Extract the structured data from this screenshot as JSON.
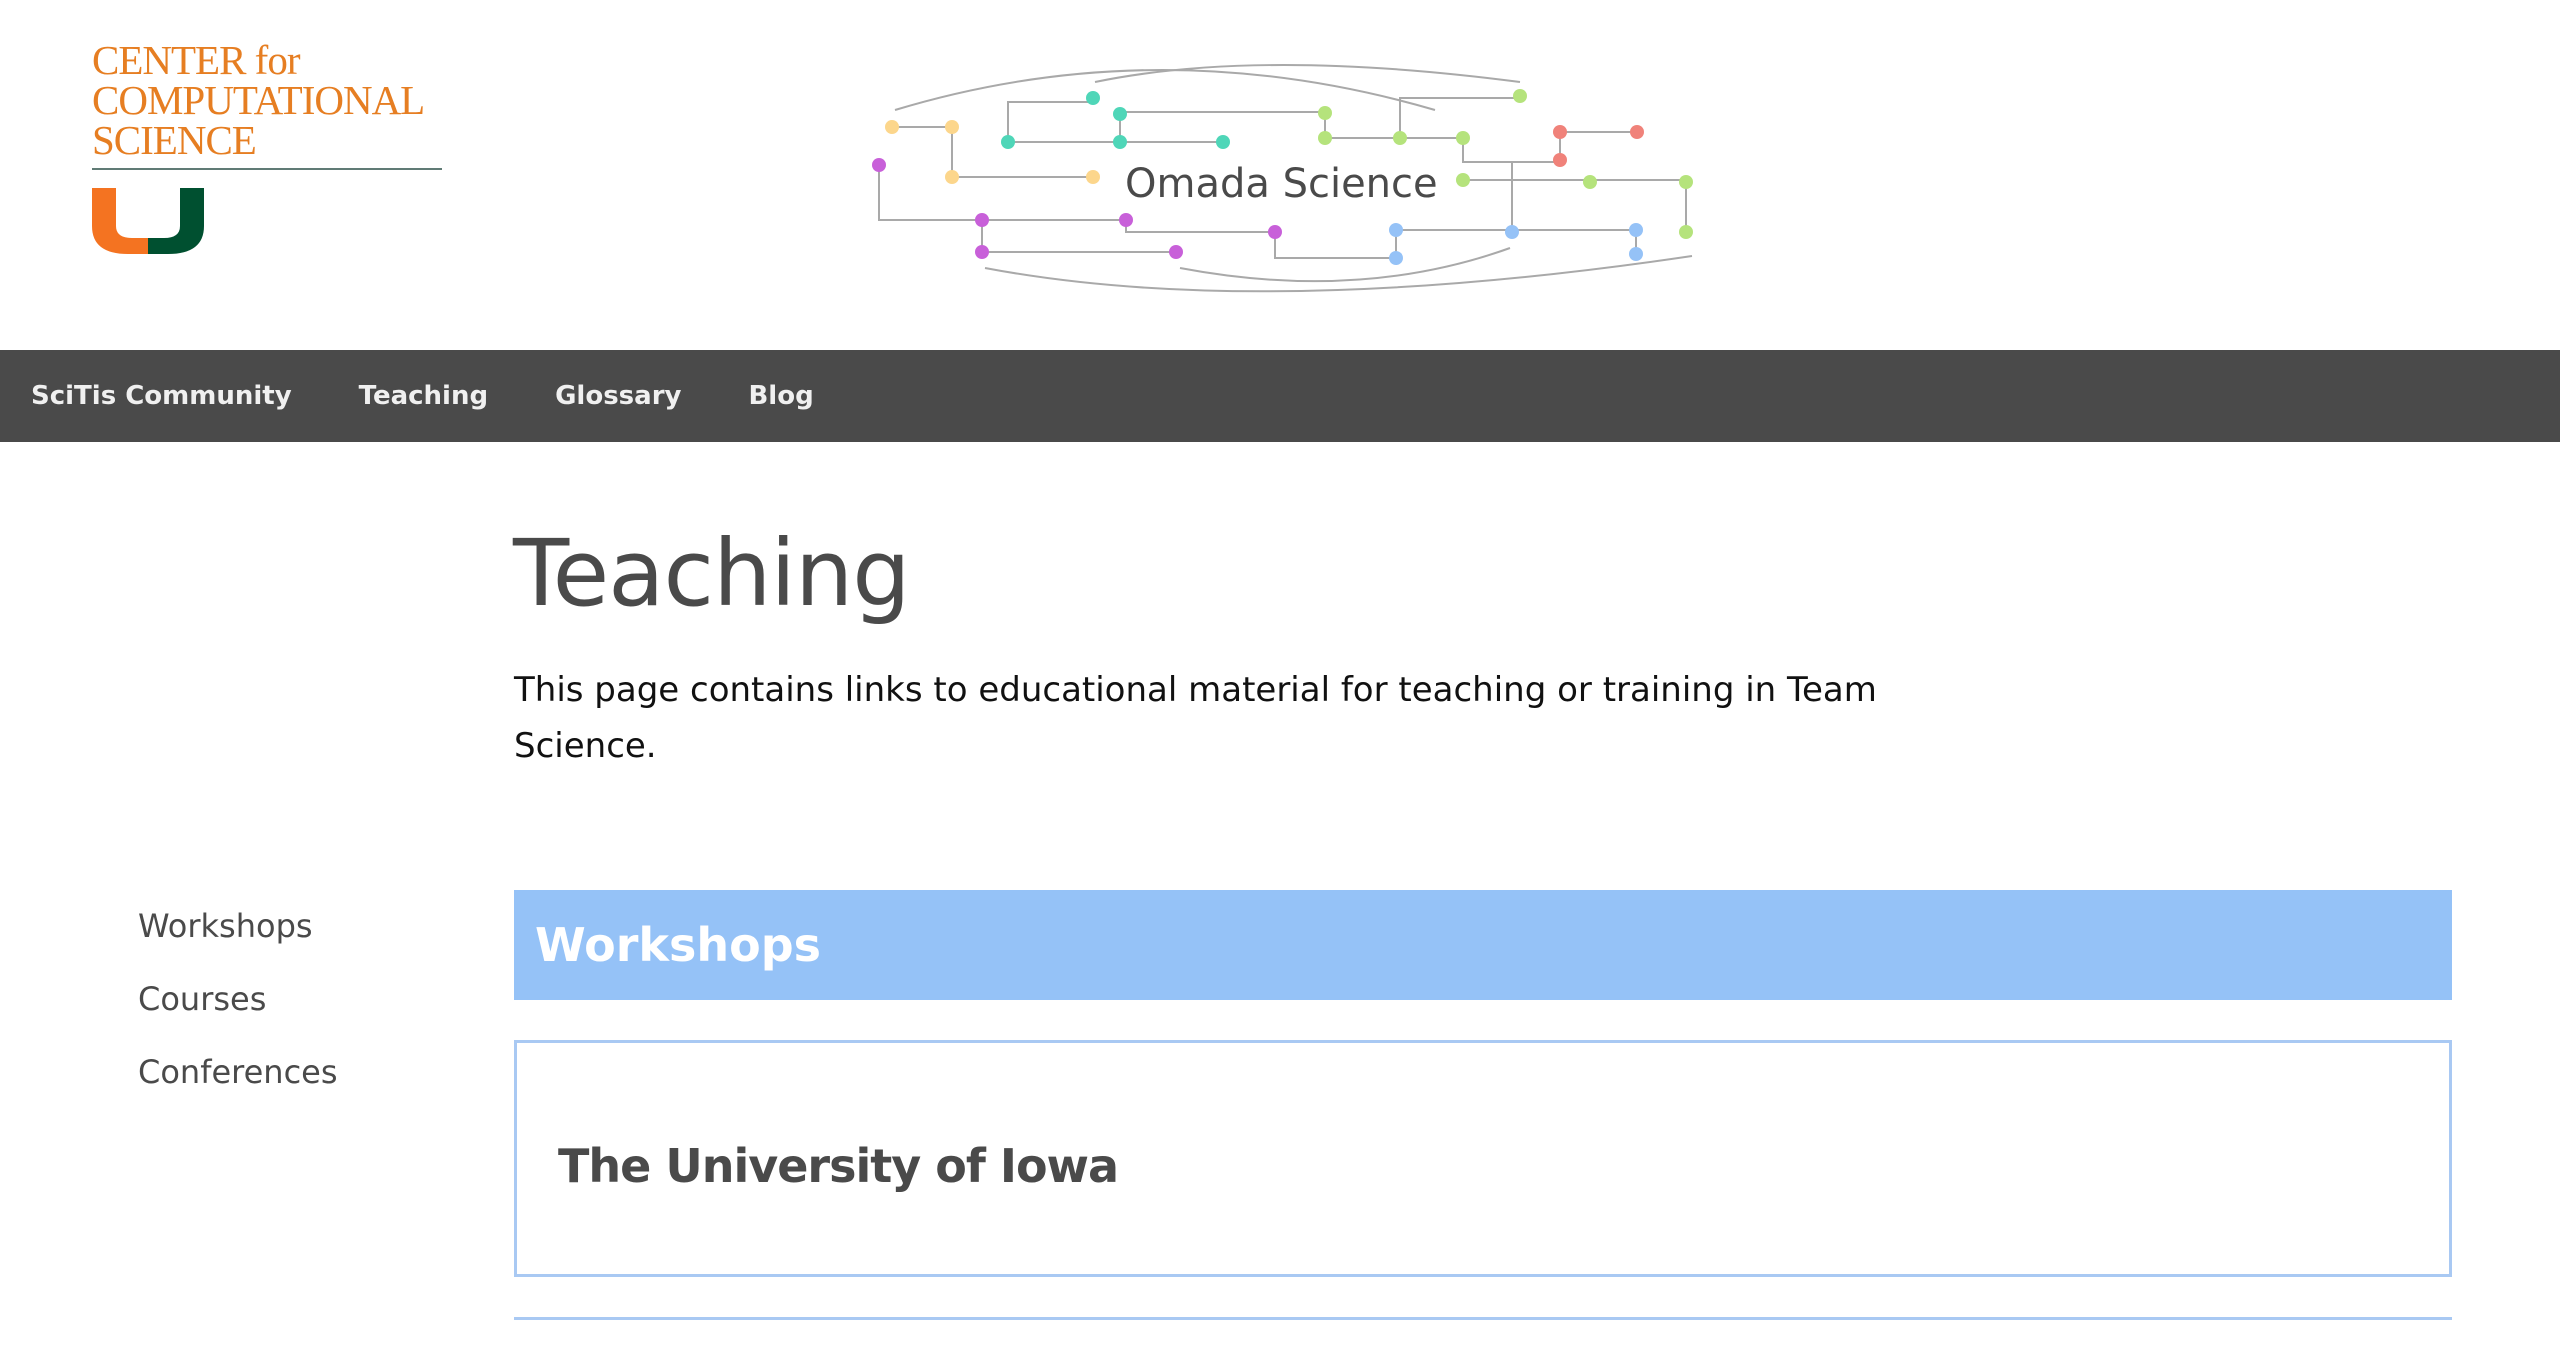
{
  "header": {
    "ccs_logo": {
      "lines": [
        "CENTER for",
        "COMPUTATIONAL",
        "SCIENCE"
      ],
      "colors": {
        "text": "#e67e22",
        "rule": "#607b75",
        "u_orange": "#f47321",
        "u_green": "#005030"
      }
    },
    "omada_logo": {
      "title": "Omada Science",
      "colors": {
        "yellow": "#fcd68c",
        "teal": "#4fd6b8",
        "green": "#b5e37c",
        "red": "#f0827a",
        "purple": "#c860d9",
        "blue": "#95c2f7",
        "line": "#a9a9a9"
      }
    }
  },
  "nav": {
    "items": [
      "SciTis Community",
      "Teaching",
      "Glossary",
      "Blog"
    ],
    "background": "#4a4a4a"
  },
  "main": {
    "title": "Teaching",
    "intro": "This page contains links to educational material for teaching or training in Team Science."
  },
  "sidebar": {
    "items": [
      "Workshops",
      "Courses",
      "Conferences"
    ]
  },
  "sections": [
    {
      "header": "Workshops",
      "header_color": "#95c2f7",
      "cards": [
        {
          "title": "The University of Iowa"
        }
      ]
    }
  ]
}
